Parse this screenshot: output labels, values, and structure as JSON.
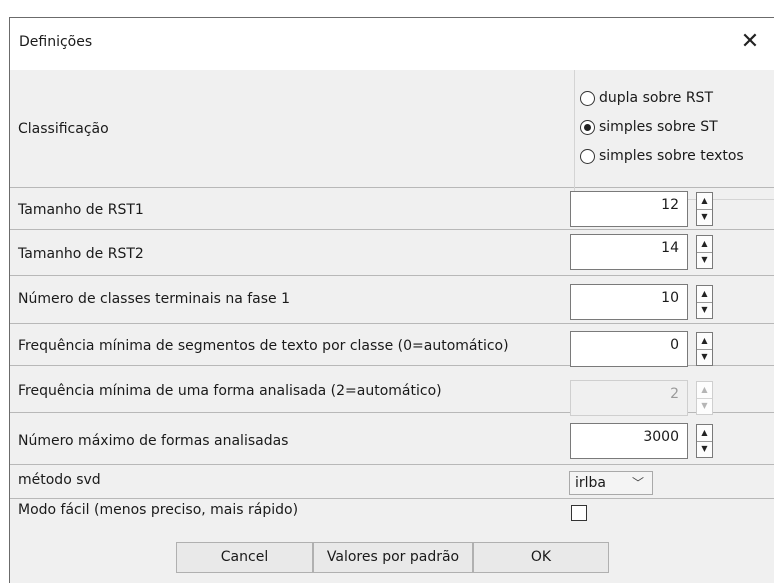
{
  "dialog": {
    "title": "Definições",
    "close_glyph": "✕"
  },
  "classification": {
    "label": "Classificação",
    "options": [
      {
        "label": "dupla sobre RST",
        "selected": false
      },
      {
        "label": "simples sobre ST",
        "selected": true
      },
      {
        "label": "simples sobre textos",
        "selected": false
      }
    ]
  },
  "fields": {
    "rst1": {
      "label": "Tamanho de RST1",
      "value": "12"
    },
    "rst2": {
      "label": "Tamanho de RST2",
      "value": "14"
    },
    "terminal_classes": {
      "label": "Número de classes terminais na fase 1",
      "value": "10"
    },
    "min_segments": {
      "label": "Frequência mínima de segmentos de texto por classe (0=automático)",
      "value": "0"
    },
    "min_form_freq": {
      "label": "Frequência mínima de uma forma analisada (2=automático)",
      "value": "2",
      "disabled": true
    },
    "max_forms": {
      "label": "Número máximo de formas analisadas",
      "value": "3000"
    },
    "svd_method": {
      "label": "método svd",
      "value": "irlba"
    },
    "easy_mode": {
      "label": "Modo fácil (menos preciso, mais rápido)",
      "checked": false
    }
  },
  "buttons": {
    "cancel": "Cancel",
    "defaults": "Valores por padrão",
    "ok": "OK"
  },
  "icons": {
    "close": "close-icon",
    "spin_up": "triangle-up-icon",
    "spin_down": "triangle-down-icon",
    "dropdown": "chevron-down-icon"
  }
}
